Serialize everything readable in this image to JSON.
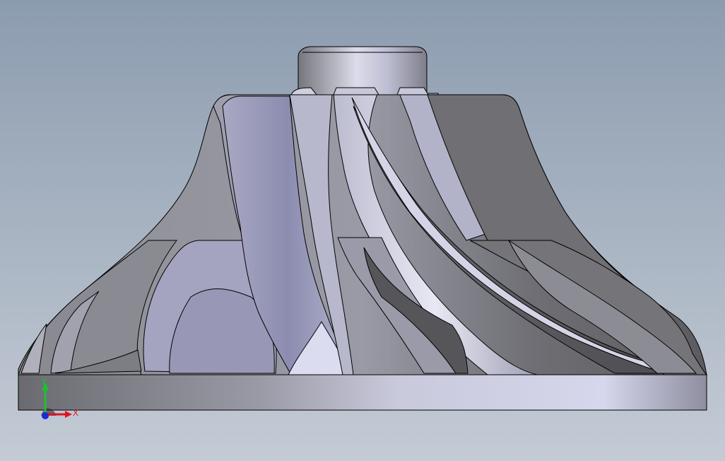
{
  "viewport": {
    "background_top": "#8c9caf",
    "background_bottom": "#c4cbd5",
    "edge_color": "#000000"
  },
  "model": {
    "name": "impeller",
    "metal_light": "#e1e1f2",
    "metal_mid": "#a8a8b8",
    "metal_dark": "#5e5e63",
    "blade_blue": "#9c9cc0"
  },
  "triad": {
    "x_label": "X",
    "y_label": "Y",
    "x_color": "#e0141e",
    "y_color": "#18c230",
    "z_color": "#1a2ad8"
  }
}
